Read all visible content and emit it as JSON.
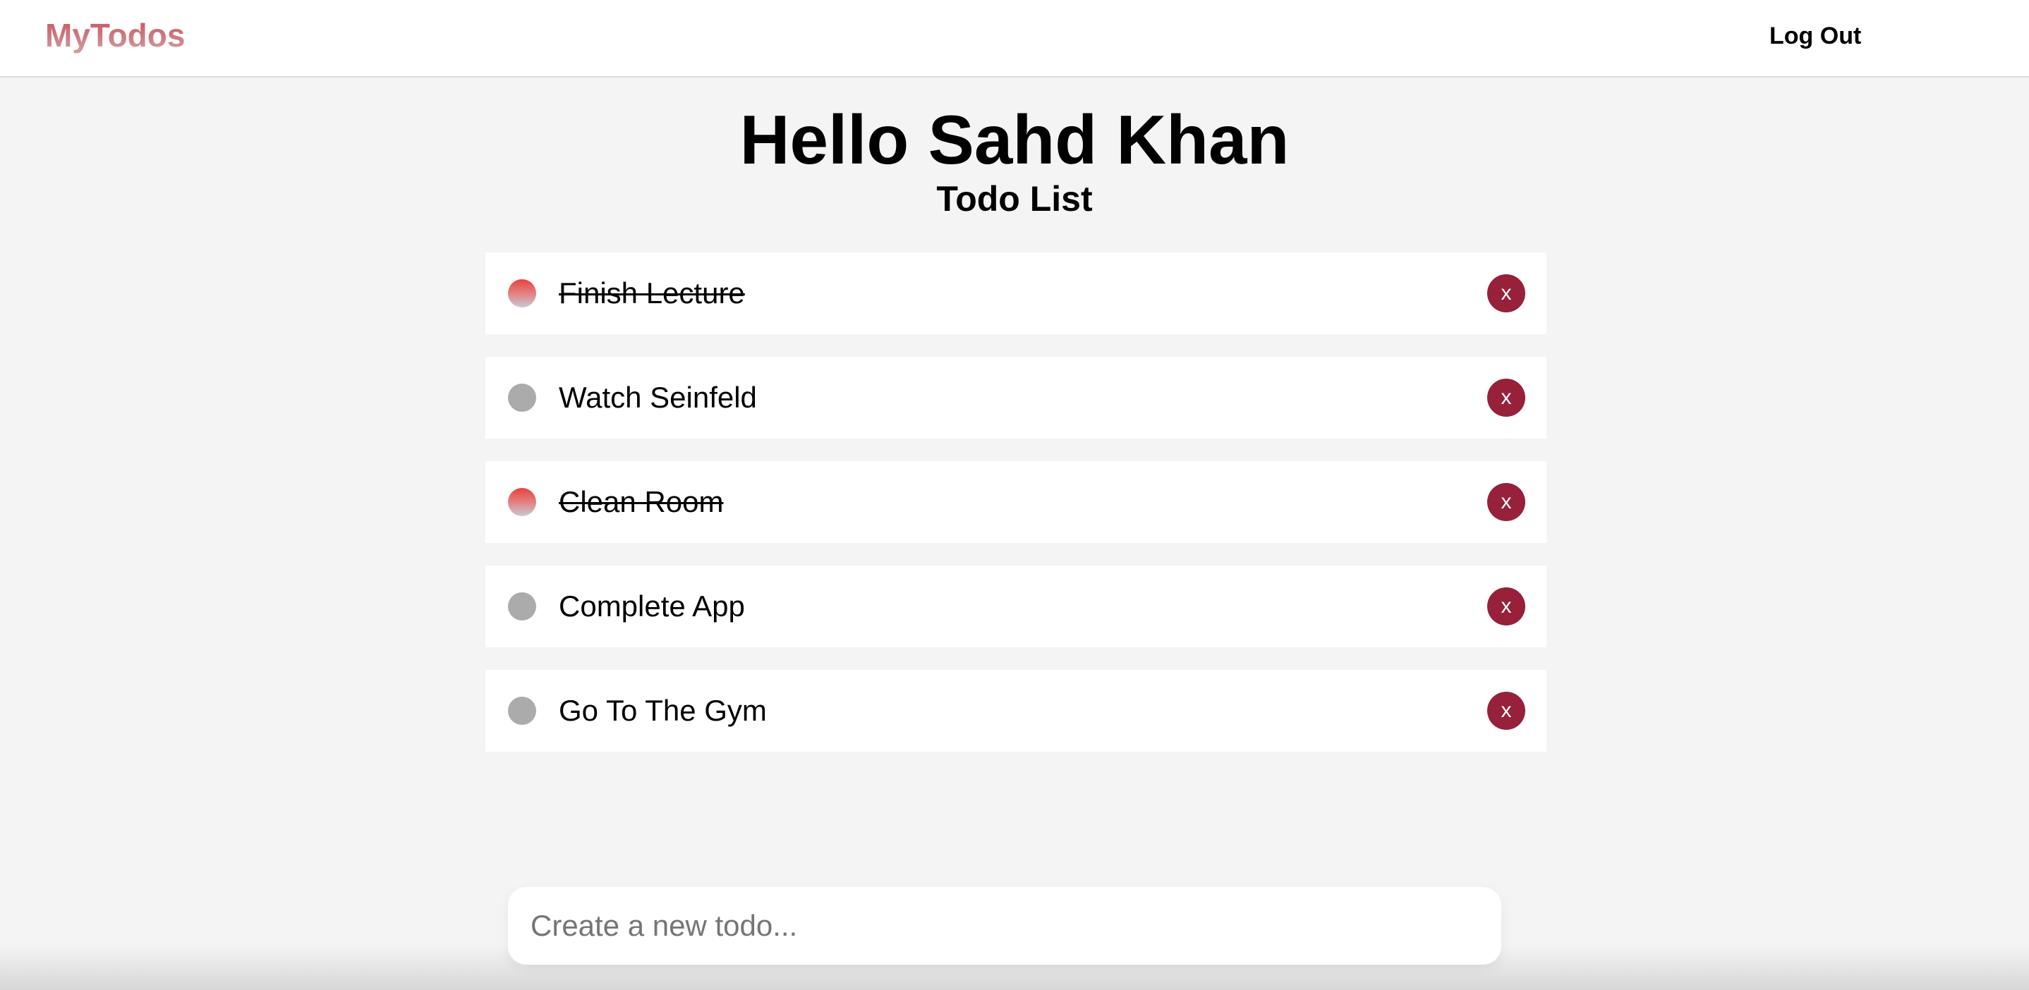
{
  "navbar": {
    "brand": "MyTodos",
    "logout_label": "Log Out"
  },
  "main": {
    "greeting": "Hello Sahd Khan",
    "list_title": "Todo List",
    "todos": [
      {
        "text": "Finish Lecture",
        "completed": true,
        "delete_label": "x"
      },
      {
        "text": "Watch Seinfeld",
        "completed": false,
        "delete_label": "x"
      },
      {
        "text": "Clean Room",
        "completed": true,
        "delete_label": "x"
      },
      {
        "text": "Complete App",
        "completed": false,
        "delete_label": "x"
      },
      {
        "text": "Go To The Gym",
        "completed": false,
        "delete_label": "x"
      }
    ],
    "new_todo": {
      "placeholder": "Create a new todo...",
      "value": ""
    }
  },
  "colors": {
    "brand": "#c84a55",
    "delete_button": "#97203b",
    "incomplete_circle": "#ababab",
    "background": "#f4f4f4"
  }
}
